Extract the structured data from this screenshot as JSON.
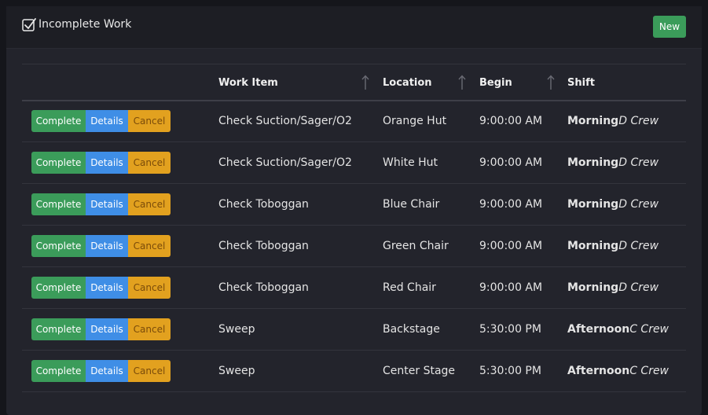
{
  "header": {
    "title": "Incomplete Work",
    "new_label": "New"
  },
  "table": {
    "columns": [
      "Work Item",
      "Location",
      "Begin",
      "Shift"
    ],
    "action_labels": {
      "complete": "Complete",
      "details": "Details",
      "cancel": "Cancel"
    },
    "rows": [
      {
        "work_item": "Check Suction/Sager/O2",
        "location": "Orange Hut",
        "begin": "9:00:00 AM",
        "shift": "Morning",
        "crew": "D Crew"
      },
      {
        "work_item": "Check Suction/Sager/O2",
        "location": "White Hut",
        "begin": "9:00:00 AM",
        "shift": "Morning",
        "crew": "D Crew"
      },
      {
        "work_item": "Check Toboggan",
        "location": "Blue Chair",
        "begin": "9:00:00 AM",
        "shift": "Morning",
        "crew": "D Crew"
      },
      {
        "work_item": "Check Toboggan",
        "location": "Green Chair",
        "begin": "9:00:00 AM",
        "shift": "Morning",
        "crew": "D Crew"
      },
      {
        "work_item": "Check Toboggan",
        "location": "Red Chair",
        "begin": "9:00:00 AM",
        "shift": "Morning",
        "crew": "D Crew"
      },
      {
        "work_item": "Sweep",
        "location": "Backstage",
        "begin": "5:30:00 PM",
        "shift": "Afternoon",
        "crew": "C Crew"
      },
      {
        "work_item": "Sweep",
        "location": "Center Stage",
        "begin": "5:30:00 PM",
        "shift": "Afternoon",
        "crew": "C Crew"
      }
    ]
  },
  "colors": {
    "complete": "#3b9c5a",
    "details": "#3f8ee6",
    "cancel": "#e2a11f",
    "background": "#23242c"
  },
  "icons": {
    "header": "checkbox-checked-icon",
    "sort": "arrow-up-icon"
  }
}
